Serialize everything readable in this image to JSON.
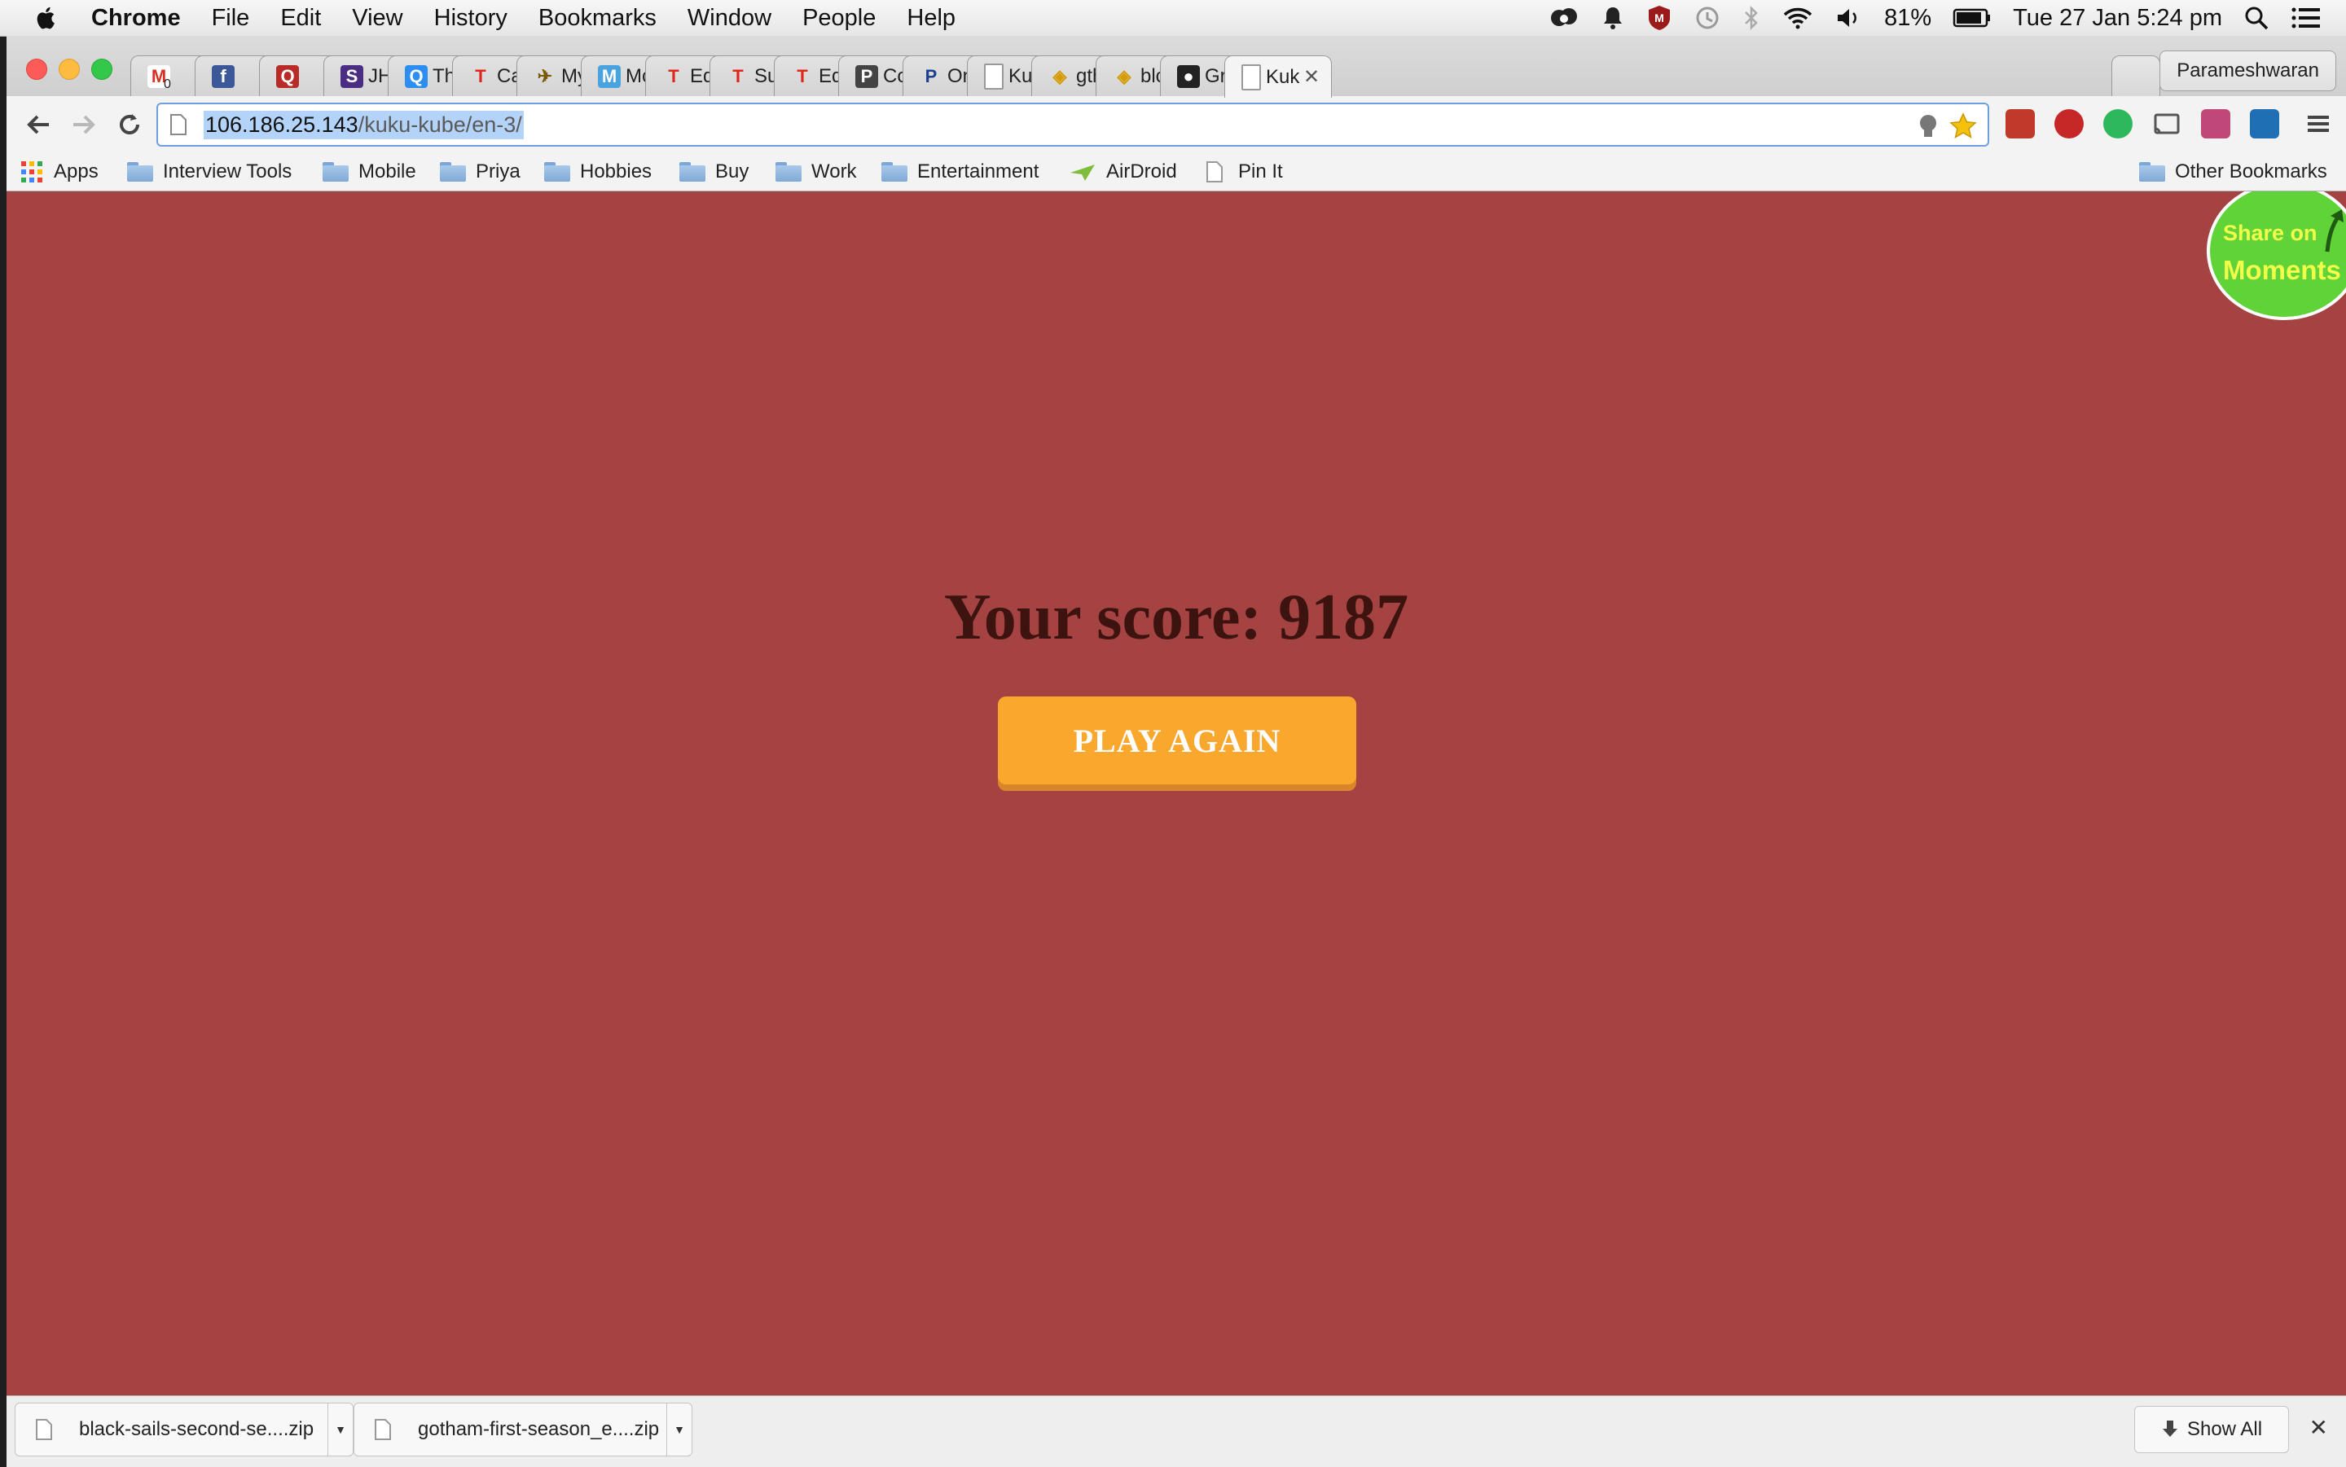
{
  "menubar": {
    "app": "Chrome",
    "menus": [
      "File",
      "Edit",
      "View",
      "History",
      "Bookmarks",
      "Window",
      "People",
      "Help"
    ],
    "battery": "81%",
    "clock": "Tue 27 Jan  5:24 pm",
    "icons": [
      "apple-logo-icon",
      "creative-cloud-icon",
      "notification-bell-icon",
      "mcafee-shield-icon",
      "time-machine-icon",
      "bluetooth-icon",
      "wifi-icon",
      "volume-icon",
      "battery-icon",
      "spotlight-search-icon",
      "notification-center-icon"
    ]
  },
  "tabs": [
    {
      "title": "",
      "icon": "gmail-icon",
      "badge": "0"
    },
    {
      "title": "",
      "icon": "facebook-icon"
    },
    {
      "title": "",
      "icon": "quora-icon"
    },
    {
      "title": "JHL",
      "icon": "s-logo-icon"
    },
    {
      "title": "The",
      "icon": "q-bubble-icon"
    },
    {
      "title": "Car",
      "icon": "t-red-icon"
    },
    {
      "title": "Mys",
      "icon": "bird-icon"
    },
    {
      "title": "McI",
      "icon": "m-blue-icon"
    },
    {
      "title": "Edit",
      "icon": "t-red-icon"
    },
    {
      "title": "Suz",
      "icon": "t-red-icon"
    },
    {
      "title": "Ed Y",
      "icon": "t-red-icon"
    },
    {
      "title": "Con",
      "icon": "p-grey-icon"
    },
    {
      "title": "Onl",
      "icon": "paypal-icon"
    },
    {
      "title": "Kuk",
      "icon": "page-icon"
    },
    {
      "title": "gthr",
      "icon": "rss-yellow-icon"
    },
    {
      "title": "blck",
      "icon": "rss-yellow-icon"
    },
    {
      "title": "Gre",
      "icon": "github-icon"
    },
    {
      "title": "Kuk",
      "icon": "page-icon",
      "active": true
    }
  ],
  "profile_name": "Parameshwaran",
  "omnibox": {
    "host": "106.186.25.143",
    "path": "/kuku-kube/en-3/"
  },
  "bookmarks": [
    "Apps",
    "Interview Tools",
    "Mobile",
    "Priya",
    "Hobbies",
    "Buy",
    "Work",
    "Entertainment",
    "AirDroid",
    "Pin It"
  ],
  "other_bookmarks": "Other Bookmarks",
  "game": {
    "score_text": "Your score: 9187",
    "play_again": "PLAY AGAIN",
    "share_line1": "Share on",
    "share_line2": "Moments",
    "colors": {
      "background": "#a54342",
      "button": "#f9a72d",
      "score_text": "#3c130f",
      "share_badge": "#5fd338"
    }
  },
  "downloads": {
    "items": [
      "black-sails-second-se....zip",
      "gotham-first-season_e....zip"
    ],
    "show_all": "Show All"
  }
}
